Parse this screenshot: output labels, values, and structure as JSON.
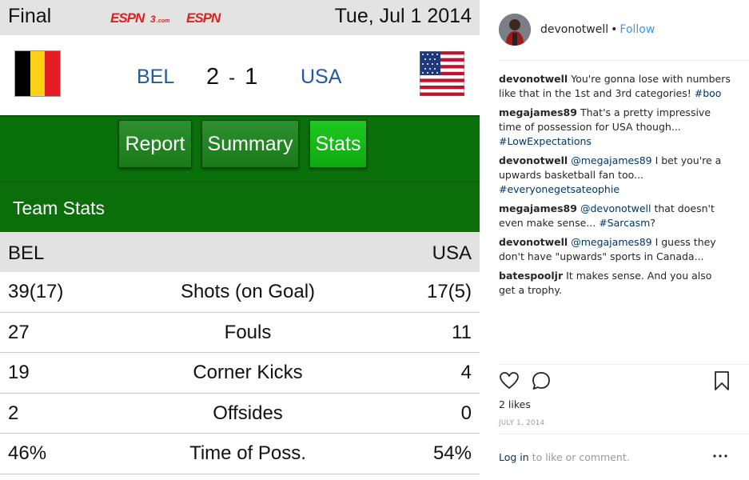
{
  "scoreboard": {
    "status": "Final",
    "date": "Tue, Jul 1 2014",
    "logo_text": "ESPN3.com ESPN",
    "home_team": "BEL",
    "away_team": "USA",
    "home_score": "2",
    "away_score": "1",
    "score_separator": "-",
    "tabs": [
      {
        "label": "Report",
        "active": false
      },
      {
        "label": "Summary",
        "active": false
      },
      {
        "label": "Stats",
        "active": true
      }
    ],
    "section_title": "Team Stats",
    "stats_header": {
      "home": "BEL",
      "away": "USA"
    },
    "stats": [
      {
        "home": "39(17)",
        "name": "Shots (on Goal)",
        "away": "17(5)"
      },
      {
        "home": "27",
        "name": "Fouls",
        "away": "11"
      },
      {
        "home": "19",
        "name": "Corner Kicks",
        "away": "4"
      },
      {
        "home": "2",
        "name": "Offsides",
        "away": "0"
      },
      {
        "home": "46%",
        "name": "Time of Poss.",
        "away": "54%"
      }
    ]
  },
  "post": {
    "username": "devonotwell",
    "follow_label": "Follow",
    "comments": [
      {
        "user": "devonotwell",
        "text": "You're gonna lose with numbers like that in the 1st and 3rd categories! ",
        "mention": "",
        "tag": "#boo"
      },
      {
        "user": "megajames89",
        "text": "That's a pretty impressive time of possession for USA though... ",
        "mention": "",
        "tag": "#LowExpectations"
      },
      {
        "user": "devonotwell",
        "mention": "@megajames89",
        "text": " I bet you're a upwards basketball fan too... ",
        "tag": "#everyonegetsateophie"
      },
      {
        "user": "megajames89",
        "mention": "@devonotwell",
        "text": " that doesn't even make sense... ",
        "tag": "#Sarcasm",
        "suffix": "?"
      },
      {
        "user": "devonotwell",
        "mention": "@megajames89",
        "text": " I guess they don't have \"upwards\" sports in Canada...",
        "tag": ""
      },
      {
        "user": "batespooljr",
        "text": "It makes sense. And you also get a trophy.",
        "mention": "",
        "tag": ""
      }
    ],
    "likes": "2 likes",
    "post_date": "JULY 1, 2014",
    "login_link": "Log in",
    "login_text": " to like or comment."
  },
  "colors": {
    "tab_green": "#0a700a",
    "tab_active": "#10a810",
    "link_blue": "#3897f0",
    "team_blue": "#1e5aa8"
  },
  "icons": [
    "heart-icon",
    "comment-icon",
    "bookmark-icon",
    "more-options-icon"
  ]
}
